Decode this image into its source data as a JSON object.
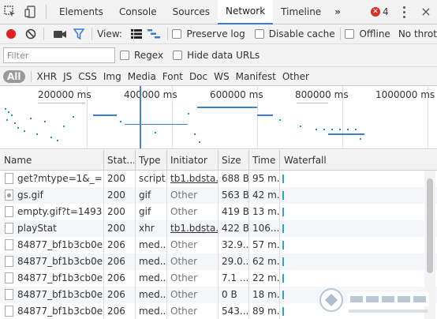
{
  "tabs": [
    "Elements",
    "Console",
    "Sources",
    "Network",
    "Timeline"
  ],
  "active_tab": "Network",
  "more_tabs_glyph": "»",
  "error_count": "4",
  "toolbar": {
    "view_label": "View:",
    "preserve_log": "Preserve log",
    "disable_cache": "Disable cache",
    "offline": "Offline",
    "throttle": "No throt"
  },
  "filter": {
    "placeholder": "Filter",
    "regex": "Regex",
    "hide_data_urls": "Hide data URLs"
  },
  "types": [
    "All",
    "XHR",
    "JS",
    "CSS",
    "Img",
    "Media",
    "Font",
    "Doc",
    "WS",
    "Manifest",
    "Other"
  ],
  "overview": {
    "labels": [
      "200000 ms",
      "400000 ms",
      "600000 ms",
      "800000 ms",
      "1000000 ms"
    ]
  },
  "columns": [
    "Name",
    "Stat...",
    "Type",
    "Initiator",
    "Size",
    "Time",
    "Waterfall"
  ],
  "rows": [
    {
      "name": "get?mtype=1&_=...",
      "status": "200",
      "type": "script",
      "initiator": "tb1.bdsta...",
      "size": "688 B",
      "time": "95 m...",
      "icon": "doc"
    },
    {
      "name": "gs.gif",
      "status": "200",
      "type": "gif",
      "initiator": "Other",
      "size": "563 B",
      "time": "42 m...",
      "icon": "img"
    },
    {
      "name": "empty.gif?t=1493...",
      "status": "200",
      "type": "gif",
      "initiator": "Other",
      "size": "419 B",
      "time": "13 m...",
      "icon": "doc"
    },
    {
      "name": "playStat",
      "status": "200",
      "type": "xhr",
      "initiator": "tb1.bdsta...",
      "size": "422 B",
      "time": "106...",
      "icon": "doc"
    },
    {
      "name": "84877_bf1b3cb0e...",
      "status": "206",
      "type": "med...",
      "initiator": "Other",
      "size": "32.9...",
      "time": "57 m...",
      "icon": "doc"
    },
    {
      "name": "84877_bf1b3cb0e...",
      "status": "206",
      "type": "med...",
      "initiator": "Other",
      "size": "29.0...",
      "time": "62 m...",
      "icon": "doc"
    },
    {
      "name": "84877_bf1b3cb0e...",
      "status": "206",
      "type": "med...",
      "initiator": "Other",
      "size": "7.1 ...",
      "time": "22 m...",
      "icon": "doc"
    },
    {
      "name": "84877_bf1b3cb0e...",
      "status": "206",
      "type": "med...",
      "initiator": "Other",
      "size": "0 B",
      "time": "18 m...",
      "icon": "doc"
    },
    {
      "name": "84877_bf1b3cb0e...",
      "status": "206",
      "type": "med...",
      "initiator": "Other",
      "size": "543...",
      "time": "89 m...",
      "icon": "doc"
    }
  ],
  "colors": {
    "accent": "#3879d9",
    "record": "#e02020",
    "error": "#d93026",
    "waterfall": "#2aa6c8"
  }
}
